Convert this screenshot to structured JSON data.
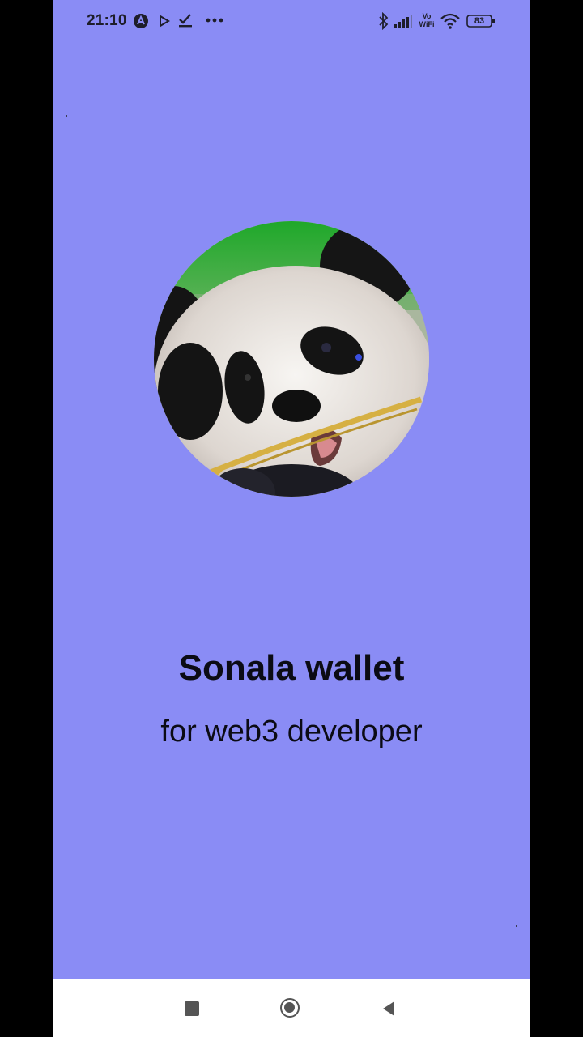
{
  "status_bar": {
    "time": "21:10",
    "battery": "83",
    "icons": [
      "app-a-icon",
      "play-icon",
      "check-download-icon",
      "more-dots-icon",
      "bluetooth-icon",
      "signal-icon",
      "vowifi-icon",
      "wifi-icon",
      "battery-icon"
    ],
    "vowifi_label_top": "Vo",
    "vowifi_label_bottom": "WiFi"
  },
  "splash": {
    "title": "Sonala wallet",
    "subtitle": "for web3 developer",
    "background_color": "#8a8cf5"
  },
  "nav_bar": {
    "buttons": [
      "recents-button",
      "home-button",
      "back-button"
    ]
  }
}
